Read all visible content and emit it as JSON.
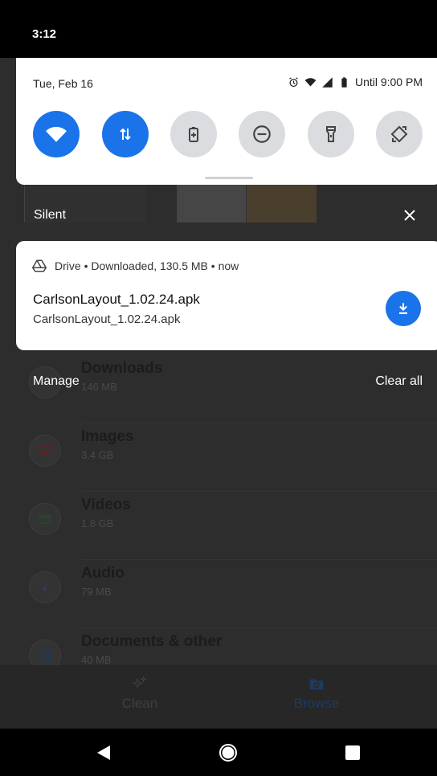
{
  "status_bar": {
    "time": "3:12"
  },
  "quick_settings": {
    "date": "Tue, Feb 16",
    "battery_text": "Until 9:00 PM",
    "status_icons": [
      "alarm-icon",
      "wifi-icon",
      "signal-icon",
      "battery-icon"
    ],
    "tiles": [
      {
        "name": "wifi",
        "icon": "wifi-icon",
        "active": true
      },
      {
        "name": "mobile-data",
        "icon": "data-arrows-icon",
        "active": true
      },
      {
        "name": "battery-saver",
        "icon": "battery-saver-icon",
        "active": false
      },
      {
        "name": "do-not-disturb",
        "icon": "do-not-disturb-icon",
        "active": false
      },
      {
        "name": "flashlight",
        "icon": "flashlight-icon",
        "active": false
      },
      {
        "name": "auto-rotate",
        "icon": "auto-rotate-icon",
        "active": false
      }
    ],
    "colors": {
      "active": "#1a73e8",
      "inactive": "#dadcdf"
    }
  },
  "silent_section": {
    "label": "Silent"
  },
  "notification": {
    "app": "Drive",
    "detail": "Downloaded, 130.5 MB",
    "time": "now",
    "separator": "•",
    "title": "CarlsonLayout_1.02.24.apk",
    "body": "CarlsonLayout_1.02.24.apk",
    "action_icon": "download-icon"
  },
  "notification_actions": {
    "manage": "Manage",
    "clear_all": "Clear all"
  },
  "background_app": {
    "categories": [
      {
        "name": "Downloads",
        "size": "146 MB",
        "icon": "download-icon"
      },
      {
        "name": "Images",
        "size": "3.4 GB",
        "icon": "image-icon"
      },
      {
        "name": "Videos",
        "size": "1.8 GB",
        "icon": "video-icon"
      },
      {
        "name": "Audio",
        "size": "79 MB",
        "icon": "music-note-icon"
      },
      {
        "name": "Documents & other",
        "size": "40 MB",
        "icon": "document-icon"
      }
    ],
    "nav": {
      "clean": "Clean",
      "browse": "Browse"
    }
  },
  "system_nav": {
    "buttons": [
      "back",
      "home",
      "recents"
    ]
  }
}
